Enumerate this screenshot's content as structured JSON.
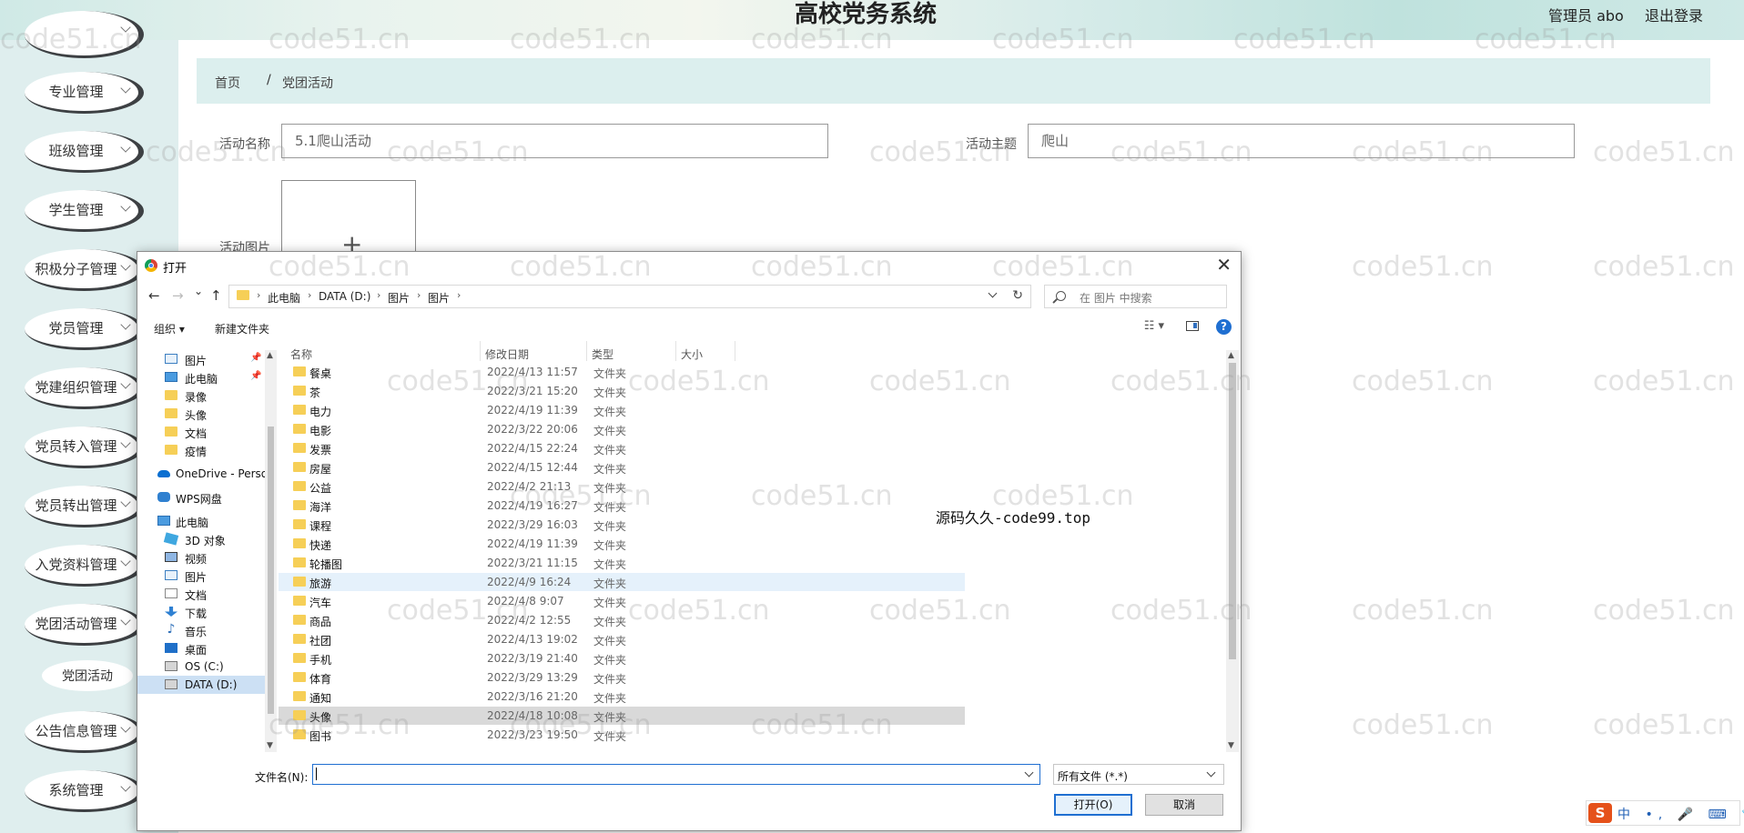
{
  "header": {
    "title": "高校党务系统",
    "admin": "管理员 abo",
    "logout": "退出登录"
  },
  "sidebar": {
    "items": [
      {
        "label": "专业管理"
      },
      {
        "label": "班级管理"
      },
      {
        "label": "学生管理"
      },
      {
        "label": "积极分子管理"
      },
      {
        "label": "党员管理"
      },
      {
        "label": "党建组织管理"
      },
      {
        "label": "党员转入管理"
      },
      {
        "label": "党员转出管理"
      },
      {
        "label": "入党资料管理"
      },
      {
        "label": "党团活动管理"
      },
      {
        "label": "公告信息管理"
      },
      {
        "label": "系统管理"
      }
    ],
    "sub_item": "党团活动"
  },
  "breadcrumb": {
    "home": "首页",
    "separator": "/",
    "current": "党团活动"
  },
  "form": {
    "activity_name_label": "活动名称",
    "activity_name_value": "5.1爬山活动",
    "activity_theme_label": "活动主题",
    "activity_theme_value": "爬山",
    "activity_image_label": "活动图片",
    "upload_plus": "+"
  },
  "watermark": "code51.cn",
  "dialog": {
    "title": "打开",
    "close": "✕",
    "nav": {
      "back": "←",
      "forward": "→",
      "recent": "⌄",
      "up": "↑",
      "refresh": "↻"
    },
    "path": [
      "此电脑",
      "DATA (D:)",
      "图片",
      "图片"
    ],
    "search_placeholder": "在 图片 中搜索",
    "toolbar": {
      "organize": "组织 ▾",
      "new_folder": "新建文件夹",
      "view": "☷ ▾",
      "help": "?"
    },
    "nav_pane": [
      {
        "label": "图片",
        "icon": "pictures-icon",
        "pinned": true
      },
      {
        "label": "此电脑",
        "icon": "computer-icon",
        "pinned": true
      },
      {
        "label": "录像",
        "icon": "folder-icon"
      },
      {
        "label": "头像",
        "icon": "folder-icon"
      },
      {
        "label": "文档",
        "icon": "folder-icon"
      },
      {
        "label": "疫情",
        "icon": "folder-icon"
      },
      {
        "label": "OneDrive - Perso",
        "icon": "onedrive-icon"
      },
      {
        "label": "WPS网盘",
        "icon": "wps-cloud-icon"
      },
      {
        "label": "此电脑",
        "icon": "computer-icon"
      },
      {
        "label": "3D 对象",
        "icon": "3d-objects-icon"
      },
      {
        "label": "视频",
        "icon": "videos-icon"
      },
      {
        "label": "图片",
        "icon": "pictures-icon"
      },
      {
        "label": "文档",
        "icon": "documents-icon"
      },
      {
        "label": "下载",
        "icon": "downloads-icon"
      },
      {
        "label": "音乐",
        "icon": "music-icon"
      },
      {
        "label": "桌面",
        "icon": "desktop-icon"
      },
      {
        "label": "OS (C:)",
        "icon": "drive-icon"
      },
      {
        "label": "DATA (D:)",
        "icon": "drive-icon",
        "selected": true
      }
    ],
    "columns": {
      "name": "名称",
      "date": "修改日期",
      "type": "类型",
      "size": "大小"
    },
    "files": [
      {
        "name": "餐桌",
        "date": "2022/4/13 11:57",
        "type": "文件夹"
      },
      {
        "name": "茶",
        "date": "2022/3/21 15:20",
        "type": "文件夹"
      },
      {
        "name": "电力",
        "date": "2022/4/19 11:39",
        "type": "文件夹"
      },
      {
        "name": "电影",
        "date": "2022/3/22 20:06",
        "type": "文件夹"
      },
      {
        "name": "发票",
        "date": "2022/4/15 22:24",
        "type": "文件夹"
      },
      {
        "name": "房屋",
        "date": "2022/4/15 12:44",
        "type": "文件夹"
      },
      {
        "name": "公益",
        "date": "2022/4/2 21:13",
        "type": "文件夹"
      },
      {
        "name": "海洋",
        "date": "2022/4/19 16:27",
        "type": "文件夹"
      },
      {
        "name": "课程",
        "date": "2022/3/29 16:03",
        "type": "文件夹"
      },
      {
        "name": "快递",
        "date": "2022/4/19 11:39",
        "type": "文件夹"
      },
      {
        "name": "轮播图",
        "date": "2022/3/21 11:15",
        "type": "文件夹"
      },
      {
        "name": "旅游",
        "date": "2022/4/9 16:24",
        "type": "文件夹",
        "hover": true
      },
      {
        "name": "汽车",
        "date": "2022/4/8 9:07",
        "type": "文件夹"
      },
      {
        "name": "商品",
        "date": "2022/4/2 12:55",
        "type": "文件夹"
      },
      {
        "name": "社团",
        "date": "2022/4/13 19:02",
        "type": "文件夹"
      },
      {
        "name": "手机",
        "date": "2022/3/19 21:40",
        "type": "文件夹"
      },
      {
        "name": "体育",
        "date": "2022/3/29 13:29",
        "type": "文件夹"
      },
      {
        "name": "通知",
        "date": "2022/3/16 21:20",
        "type": "文件夹"
      },
      {
        "name": "头像",
        "date": "2022/4/18 10:08",
        "type": "文件夹",
        "selected": true
      },
      {
        "name": "图书",
        "date": "2022/3/23 19:50",
        "type": "文件夹"
      }
    ],
    "overlay_text": "源码久久-code99.top",
    "filename_label": "文件名(N):",
    "filename_value": "",
    "filetype": "所有文件 (*.*)",
    "open_button": "打开(O)",
    "cancel_button": "取消"
  },
  "ime": {
    "logo": "S",
    "text": "中 •, 🎤 ⌨ 👕 ⊞"
  }
}
